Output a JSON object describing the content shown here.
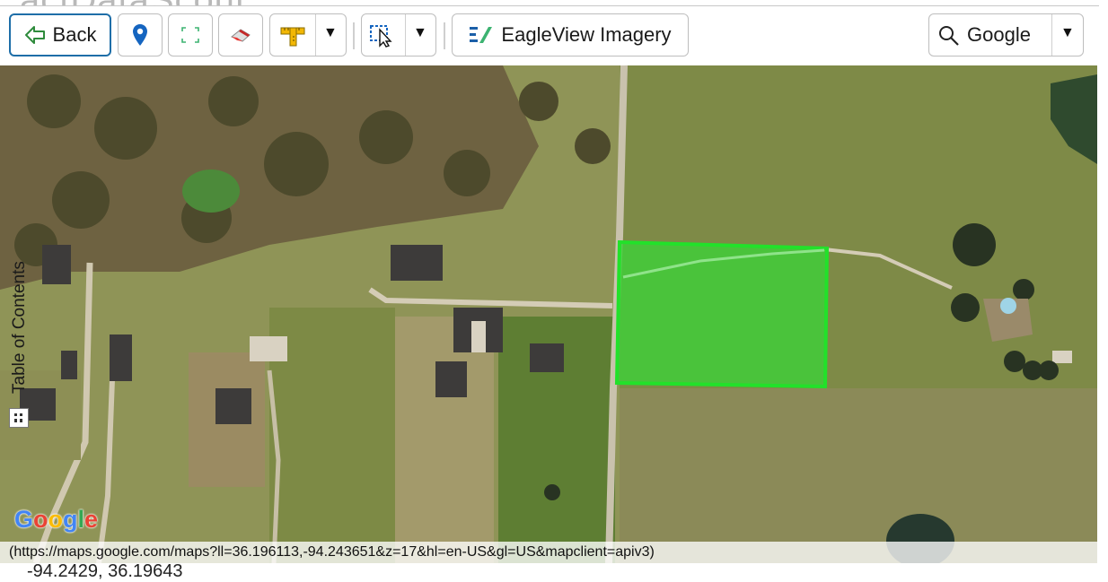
{
  "app": {
    "title_fragment": "actDataScout"
  },
  "toolbar": {
    "back_label": "Back",
    "imagery_label": "EagleView Imagery",
    "search_provider_label": "Google",
    "caret": "▼"
  },
  "map": {
    "toc_label": "Table of Contents",
    "google_logo": "Google",
    "url_text": "(https://maps.google.com/maps?ll=36.196113,-94.243651&z=17&hl=en-US&gl=US&mapclient=apiv3)",
    "coordinate_fragment": "-94.2429, 36.19643",
    "selection_color": "#22e12a"
  }
}
